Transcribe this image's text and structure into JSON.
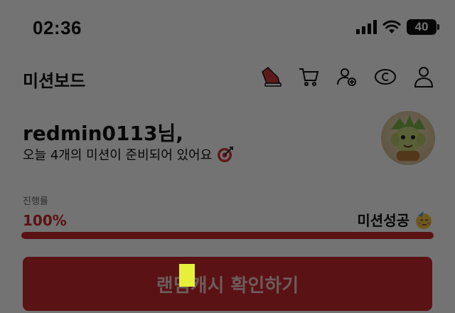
{
  "status_bar": {
    "time": "02:36",
    "battery": "40"
  },
  "header": {
    "title": "미션보드",
    "icons": [
      "sneaker-icon",
      "cart-icon",
      "add-friend-icon",
      "coin-icon",
      "profile-icon"
    ]
  },
  "greeting": {
    "title": "redmin0113님,",
    "subtitle": "오늘 4개의 미션이 준비되어 있어요"
  },
  "progress": {
    "label": "진행률",
    "value_text": "100%",
    "fraction": 1.0,
    "status": "미션성공"
  },
  "cta": {
    "label": "랜덤캐시 확인하기"
  },
  "colors": {
    "accent": "#c8282e",
    "cursor": "#e6f03a"
  }
}
